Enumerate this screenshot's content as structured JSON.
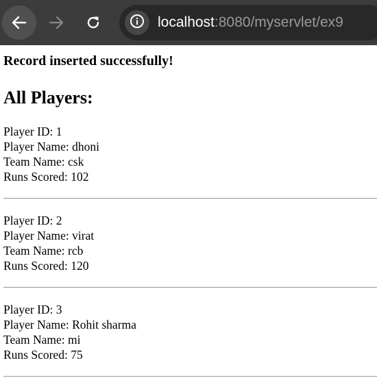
{
  "browser": {
    "url_host": "localhost",
    "url_rest": ":8080/myservlet/ex9",
    "icons": {
      "back": "arrow-left-icon",
      "forward": "arrow-right-icon",
      "reload": "reload-icon",
      "site_info": "info-icon"
    }
  },
  "page": {
    "status_message": "Record inserted successfully!",
    "heading": "All Players:",
    "players": [
      {
        "id_line": "Player ID: 1",
        "name_line": "Player Name: dhoni",
        "team_line": "Team Name: csk",
        "runs_line": "Runs Scored: 102"
      },
      {
        "id_line": "Player ID: 2",
        "name_line": "Player Name: virat",
        "team_line": "Team Name: rcb",
        "runs_line": "Runs Scored: 120"
      },
      {
        "id_line": "Player ID: 3",
        "name_line": "Player Name: Rohit sharma",
        "team_line": "Team Name: mi",
        "runs_line": "Runs Scored: 75"
      }
    ]
  }
}
